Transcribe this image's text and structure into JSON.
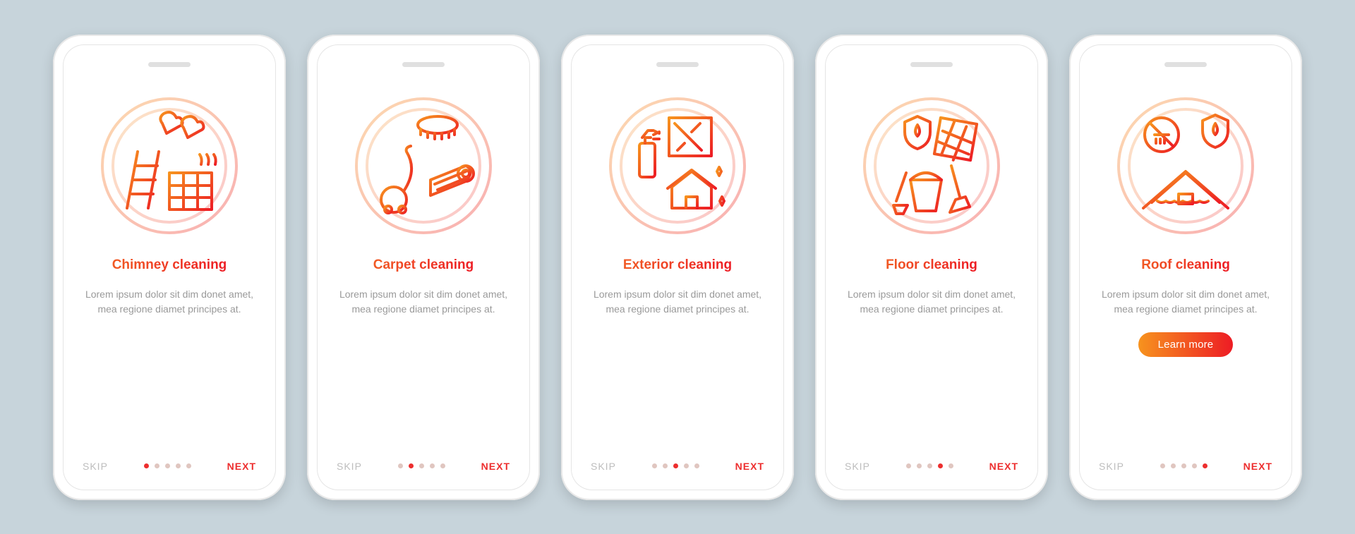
{
  "common": {
    "skip_label": "SKIP",
    "next_label": "NEXT",
    "description": "Lorem ipsum dolor sit dim donet amet, mea regione diamet principes at."
  },
  "screens": [
    {
      "title": "Chimney cleaning",
      "icon": "chimney-cleaning-icon",
      "active_dot": 0,
      "has_cta": false
    },
    {
      "title": "Carpet cleaning",
      "icon": "carpet-cleaning-icon",
      "active_dot": 1,
      "has_cta": false
    },
    {
      "title": "Exterior cleaning",
      "icon": "exterior-cleaning-icon",
      "active_dot": 2,
      "has_cta": false
    },
    {
      "title": "Floor cleaning",
      "icon": "floor-cleaning-icon",
      "active_dot": 3,
      "has_cta": false
    },
    {
      "title": "Roof cleaning",
      "icon": "roof-cleaning-icon",
      "active_dot": 4,
      "has_cta": true,
      "cta_label": "Learn more"
    }
  ],
  "colors": {
    "grad_start": "#f7931e",
    "grad_end": "#ed1c24",
    "bg": "#c7d4db"
  }
}
